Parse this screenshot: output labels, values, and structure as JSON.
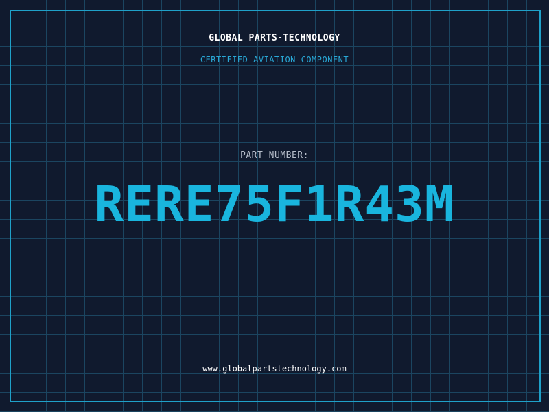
{
  "header": {
    "company_name": "GLOBAL PARTS-TECHNOLOGY",
    "tagline": "CERTIFIED AVIATION COMPONENT"
  },
  "part": {
    "label": "PART NUMBER:",
    "number": "RERE75F1R43M"
  },
  "footer": {
    "website": "www.globalpartstechnology.com"
  },
  "colors": {
    "background": "#101a2e",
    "grid": "#1b4560",
    "accent": "#19b5de",
    "frame": "#1fa1c9",
    "label": "#b6bdca",
    "text": "#ffffff"
  }
}
